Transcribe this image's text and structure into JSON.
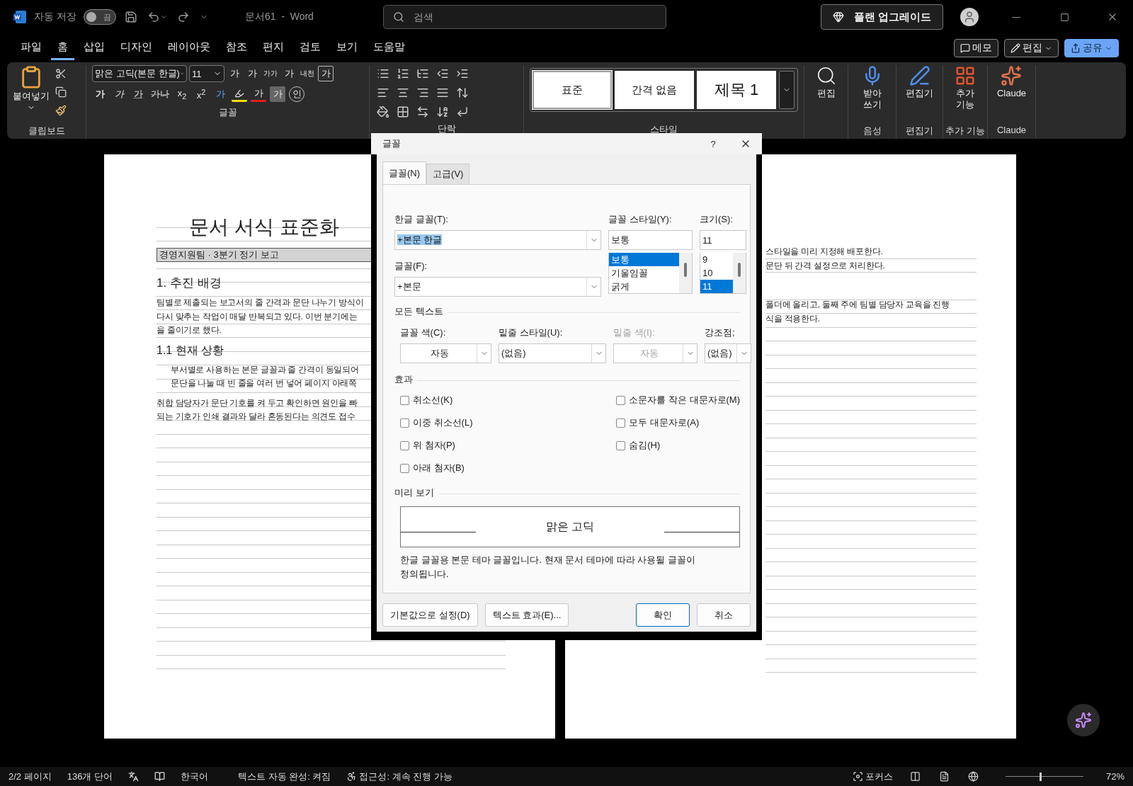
{
  "title_bar": {
    "autosave_label": "자동 저장",
    "autosave": {
      "on": false,
      "label": "끔"
    },
    "document_title": "문서61  -  Word",
    "search": {
      "placeholder": "검색"
    },
    "upgrade_button": "플랜 업그레이드"
  },
  "menu_tabs": [
    {
      "label": "파일",
      "selected": false
    },
    {
      "label": "홈",
      "selected": true
    },
    {
      "label": "삽입",
      "selected": false
    },
    {
      "label": "디자인",
      "selected": false
    },
    {
      "label": "레이아웃",
      "selected": false
    },
    {
      "label": "참조",
      "selected": false
    },
    {
      "label": "편지",
      "selected": false
    },
    {
      "label": "검토",
      "selected": false
    },
    {
      "label": "보기",
      "selected": false
    },
    {
      "label": "도움말",
      "selected": false
    }
  ],
  "menu_actions": [
    {
      "label": "메모",
      "kind": "comment"
    },
    {
      "label": "편집",
      "kind": "editing"
    },
    {
      "label": "공유",
      "kind": "share"
    }
  ],
  "ribbon": {
    "clipboard": {
      "paste": "붙여넣기",
      "label": "클립보드"
    },
    "font": {
      "name": "맑은 고딕(본문 한글)",
      "size": "11",
      "label": "글꼴",
      "row_1": [
        {
          "label": "가",
          "kind": "grow"
        },
        {
          "label": "가",
          "kind": "shrink"
        },
        {
          "label": "가가",
          "kind": "case"
        },
        {
          "label": "가",
          "kind": "clear"
        },
        {
          "label": "내천",
          "kind": "phonetic"
        },
        {
          "label": "가",
          "kind": "border"
        }
      ],
      "row_2": [
        {
          "label": "가",
          "kind": "bold"
        },
        {
          "label": "가",
          "kind": "italic"
        },
        {
          "label": "가",
          "kind": "underline"
        },
        {
          "label": "가나",
          "kind": "strike"
        },
        {
          "label": "x$_{2}$",
          "kind": "script"
        },
        {
          "label": "x$^{2}$",
          "kind": "script"
        },
        {
          "label": "가",
          "kind": "effects"
        },
        {
          "kind": "highlight"
        },
        {
          "label": "가",
          "kind": "color"
        },
        {
          "label": "가",
          "kind": "shading"
        },
        {
          "label": "인",
          "kind": "enclose"
        }
      ]
    },
    "paragraph": {
      "label": "단락"
    },
    "styles": {
      "label": "스타일",
      "items": [
        {
          "label": "표준",
          "selected": true,
          "kind": "normal"
        },
        {
          "label": "간격 없음",
          "selected": false,
          "kind": "normal"
        },
        {
          "label": "제목 1",
          "selected": false,
          "kind": "heading"
        }
      ]
    },
    "commands": [
      {
        "label": "편집",
        "kind": "search"
      },
      {
        "label": "받아\n쓰기",
        "group": "음성",
        "kind": "mic"
      },
      {
        "label": "편집기",
        "group": "편집기",
        "kind": "editor"
      },
      {
        "label": "추가\n기능",
        "group": "추가 기능",
        "kind": "addins"
      },
      {
        "label": "Claude",
        "group": "Claude",
        "kind": "claude"
      }
    ]
  },
  "document": {
    "left_page": [
      {
        "kind": "title",
        "text": "문서 서식 표준화"
      },
      {
        "kind": "banner",
        "text": "경영지원팀 · 3분기 정기 보고"
      },
      {
        "kind": "heading",
        "text": "1. 추진 배경"
      },
      {
        "kind": "paragraph",
        "lines": [
          "팀별로 제출되는 보고서의 줄 간격과 문단 나누기 방식이",
          "다시 맞추는 작업이 매달 반복되고 있다. 이번 분기에는",
          "을 줄이기로 했다."
        ]
      },
      {
        "kind": "subheading",
        "text": "1.1 현재 상황"
      },
      {
        "kind": "indented",
        "lines": [
          "부서별로 사용하는 본문 글꼴과 줄 간격이 동일되어",
          "문단을 나눌 때 빈 줄을 여러 번 넣어 페이지 아래쪽"
        ]
      },
      {
        "kind": "paragraph",
        "lines": [
          "취합 담당자가 문단 기호를 켜 두고 확인하면 원인을 빠",
          "되는 기호가 인쇄 결과와 달라 혼동된다는 의견도 접수"
        ]
      }
    ],
    "right_page": [
      {
        "lines": [
          "스타일을 미리 지정해 배포한다.",
          "문단 뒤 간격 설정으로 처리한다."
        ]
      },
      {
        "lines": [
          "폴더에 올리고, 둘째 주에 팀별 담당자 교육을 진행",
          "식을 적용한다."
        ]
      }
    ]
  },
  "font_dialog": {
    "title": "글꼴",
    "help": "?",
    "tabs": [
      {
        "label": "글꼴(N)",
        "selected": true
      },
      {
        "label": "고급(V)",
        "selected": false
      }
    ],
    "korean_font": {
      "label": "한글 글꼴(T):",
      "value": "+본문 한글"
    },
    "font": {
      "label": "글꼴(F):",
      "value": "+본문"
    },
    "style": {
      "label": "글꼴 스타일(Y):",
      "value": "보통",
      "options": [
        {
          "label": "보통",
          "selected": true
        },
        {
          "label": "기울임꼴",
          "selected": false
        },
        {
          "label": "굵게",
          "selected": false
        }
      ]
    },
    "size": {
      "label": "크기(S):",
      "value": "11",
      "options": [
        {
          "label": "9",
          "selected": false
        },
        {
          "label": "10",
          "selected": false
        },
        {
          "label": "11",
          "selected": true
        }
      ]
    },
    "all_text": {
      "label": "모든 텍스트",
      "fields": [
        {
          "label": "글꼴 색(C):",
          "value": "자동",
          "disabled": false,
          "centered": true
        },
        {
          "label": "밑줄 스타일(U):",
          "value": "(없음)",
          "disabled": false,
          "centered": false
        },
        {
          "label": "밑줄 색(I):",
          "value": "자동",
          "disabled": true,
          "centered": true
        },
        {
          "label": "강조점;",
          "value": "(없음)",
          "disabled": false,
          "centered": false
        }
      ]
    },
    "effects": {
      "label": "효과",
      "column_1": [
        {
          "label": "취소선(K)",
          "checked": false
        },
        {
          "label": "이중 취소선(L)",
          "checked": false
        },
        {
          "label": "위 첨자(P)",
          "checked": false
        },
        {
          "label": "아래 첨자(B)",
          "checked": false
        }
      ],
      "column_2": [
        {
          "label": "소문자를 작은 대문자로(M)",
          "checked": false
        },
        {
          "label": "모두 대문자로(A)",
          "checked": false
        },
        {
          "label": "숨김(H)",
          "checked": false
        }
      ]
    },
    "preview": {
      "label": "미리 보기",
      "sample": "맑은 고딕",
      "description": "한글 글꼴용 본문 테마 글꼴입니다. 현재 문서 테마에 따라 사용될 글꼴이\n정의됩니다."
    },
    "buttons": [
      {
        "label": "기본값으로 설정(D)",
        "kind": "left"
      },
      {
        "label": "텍스트 효과(E)...",
        "kind": "left"
      },
      {
        "label": "확인",
        "kind": "default"
      },
      {
        "label": "취소",
        "kind": "normal"
      }
    ]
  },
  "status_bar": {
    "page": "2/2 페이지",
    "words": "136개 단어",
    "language": "한국어",
    "autocomplete": "텍스트 자동 완성: 켜짐",
    "accessibility": "접근성: 계속 진행 가능",
    "focus": "포커스",
    "zoom": {
      "level": 0.44,
      "reading": "72%"
    }
  }
}
